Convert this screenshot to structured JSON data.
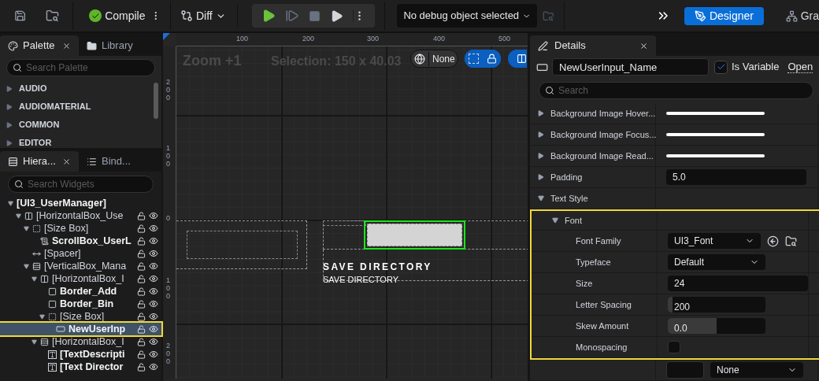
{
  "toolbar": {
    "compile": "Compile",
    "diff": "Diff",
    "debug_selector": "No debug object selected",
    "modes": [
      {
        "label": "Designer",
        "kind": "designer",
        "selected": true
      },
      {
        "label": "Gra",
        "kind": "graph",
        "selected": false
      }
    ]
  },
  "palette": {
    "tabs": [
      {
        "label": "Palette",
        "kind": "palette",
        "selected": true,
        "closable": true
      },
      {
        "label": "Library",
        "kind": "library",
        "selected": false,
        "closable": false
      }
    ],
    "search_placeholder": "Search Palette",
    "categories": [
      {
        "label": "AUDIO",
        "expanded": false
      },
      {
        "label": "AUDIOMATERIAL",
        "expanded": false
      },
      {
        "label": "COMMON",
        "expanded": false
      },
      {
        "label": "EDITOR",
        "expanded": false
      }
    ]
  },
  "hierarchy": {
    "tabs": [
      {
        "label": "Hiera...",
        "kind": "hierarchy",
        "selected": true,
        "closable": true
      },
      {
        "label": "Bind...",
        "kind": "bindings",
        "selected": false,
        "closable": false
      }
    ],
    "search_placeholder": "Search Widgets",
    "tree": [
      {
        "label": "[UI3_UserManager]",
        "kind": "root",
        "is_variable": true,
        "expanded": true,
        "selected": false,
        "children": [
          {
            "label": "[HorizontalBox_Use",
            "kind": "hbox",
            "is_variable": false,
            "expanded": true,
            "selected": false,
            "children": [
              {
                "label": "[Size Box]",
                "kind": "sizebox",
                "is_variable": false,
                "expanded": true,
                "selected": false,
                "children": [
                  {
                    "label": "ScrollBox_UserL",
                    "kind": "scrollbox",
                    "is_variable": true,
                    "selected": false
                  }
                ]
              },
              {
                "label": "[Spacer]",
                "kind": "spacer",
                "is_variable": false,
                "selected": false
              },
              {
                "label": "[VerticalBox_Mana",
                "kind": "vbox",
                "is_variable": false,
                "expanded": true,
                "selected": false,
                "children": [
                  {
                    "label": "[HorizontalBox_I",
                    "kind": "hbox",
                    "is_variable": false,
                    "expanded": true,
                    "selected": false,
                    "children": [
                      {
                        "label": "Border_Add",
                        "kind": "border",
                        "is_variable": true,
                        "selected": false
                      },
                      {
                        "label": "Border_Bin",
                        "kind": "border",
                        "is_variable": true,
                        "selected": false
                      },
                      {
                        "label": "[Size Box]",
                        "kind": "sizebox",
                        "is_variable": false,
                        "expanded": true,
                        "selected": false,
                        "children": [
                          {
                            "label": "NewUserInp",
                            "kind": "textbox",
                            "is_variable": true,
                            "selected": true,
                            "highlighted": true
                          }
                        ]
                      }
                    ]
                  },
                  {
                    "label": "[HorizontalBox_I",
                    "kind": "vbox",
                    "is_variable": false,
                    "expanded": true,
                    "selected": false,
                    "children": [
                      {
                        "label": "[TextDescripti",
                        "kind": "text",
                        "is_variable": true,
                        "selected": false
                      },
                      {
                        "label": "[Text Director",
                        "kind": "text",
                        "is_variable": true,
                        "selected": false
                      }
                    ]
                  }
                ]
              }
            ]
          }
        ]
      }
    ]
  },
  "canvas": {
    "top_ruler": [
      "100",
      "200",
      "300",
      "400",
      "500"
    ],
    "left_ruler": [
      "200",
      "100",
      "0",
      "100",
      "200"
    ],
    "zoom": "Zoom +1",
    "selection": "Selection: 150 x 40.03",
    "localization": "None",
    "toggles": [
      {
        "kind": "outline",
        "on": true
      },
      {
        "kind": "lock",
        "on": true
      },
      {
        "kind": "layout",
        "on": true
      }
    ],
    "widget_texts": [
      {
        "text": "SAVE DIRECTORY",
        "kind": "heading"
      },
      {
        "text": "SAVE DIRECTORY",
        "kind": "plain"
      }
    ]
  },
  "details": {
    "tab": "Details",
    "widget_name": "NewUserInput_Name",
    "is_variable": {
      "label": "Is Variable",
      "checked": true
    },
    "open_link": "Open",
    "search_placeholder": "Search",
    "properties": [
      {
        "label": "Background Image Hover...",
        "kind": "brush",
        "expanded": false
      },
      {
        "label": "Background Image Focus...",
        "kind": "brush",
        "expanded": false
      },
      {
        "label": "Background Image Read...",
        "kind": "brush",
        "expanded": false
      },
      {
        "label": "Padding",
        "kind": "number",
        "value": "5.0",
        "expanded": false
      },
      {
        "label": "Text Style",
        "kind": "group",
        "expanded": true,
        "children": [
          {
            "label": "Font",
            "kind": "group",
            "expanded": true,
            "highlighted": true,
            "children": [
              {
                "label": "Font Family",
                "kind": "asset",
                "value": "UI3_Font"
              },
              {
                "label": "Typeface",
                "kind": "dropdown",
                "value": "Default"
              },
              {
                "label": "Size",
                "kind": "number",
                "value": "24"
              },
              {
                "label": "Letter Spacing",
                "kind": "slider",
                "value": "200",
                "level": 0.05
              },
              {
                "label": "Skew Amount",
                "kind": "slider",
                "value": "0.0",
                "level": 0.5
              },
              {
                "label": "Monospacing",
                "kind": "checkbox",
                "checked": false
              }
            ]
          },
          {
            "kind": "material",
            "value": "None"
          }
        ]
      }
    ]
  }
}
